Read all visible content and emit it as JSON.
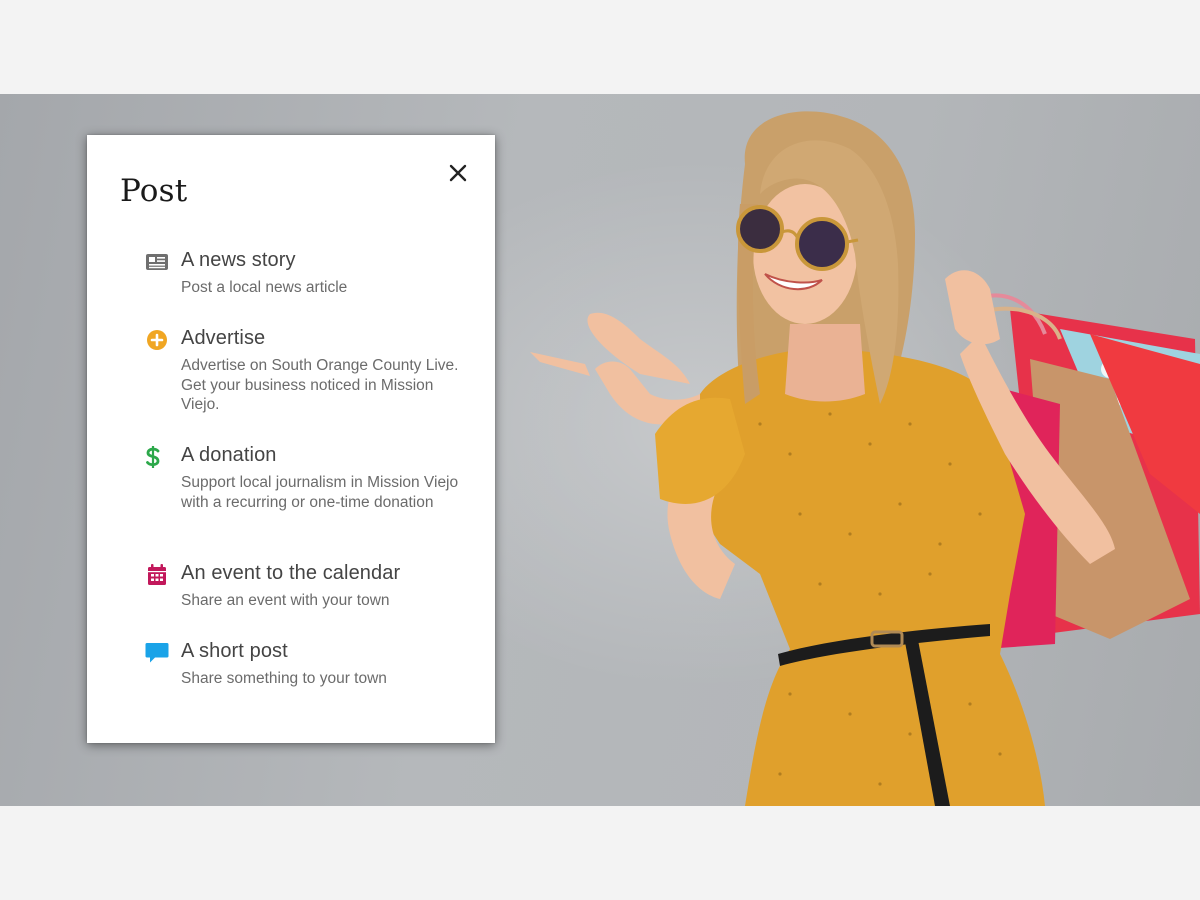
{
  "dialog": {
    "title": "Post",
    "close_icon": "close-icon"
  },
  "options": [
    {
      "icon": "newspaper-icon",
      "icon_color": "#6f6f6f",
      "label": "A news story",
      "description": "Post a local news article"
    },
    {
      "icon": "plus-circle-icon",
      "icon_color": "#f0a623",
      "label": "Advertise",
      "description": "Advertise on South Orange County Live. Get your business noticed in Mission Viejo."
    },
    {
      "icon": "dollar-icon",
      "icon_color": "#2ca84a",
      "label": "A donation",
      "description": "Support local journalism in Mission Viejo with a recurring or one-time donation"
    },
    {
      "icon": "calendar-icon",
      "icon_color": "#c2185b",
      "label": "An event to the calendar",
      "description": "Share an event with your town"
    },
    {
      "icon": "chat-bubble-icon",
      "icon_color": "#1aa3e8",
      "label": "A short post",
      "description": "Share something to your town"
    }
  ],
  "background_photo": {
    "subject": "woman in yellow dress with sunglasses holding shopping bags, pointing left"
  }
}
